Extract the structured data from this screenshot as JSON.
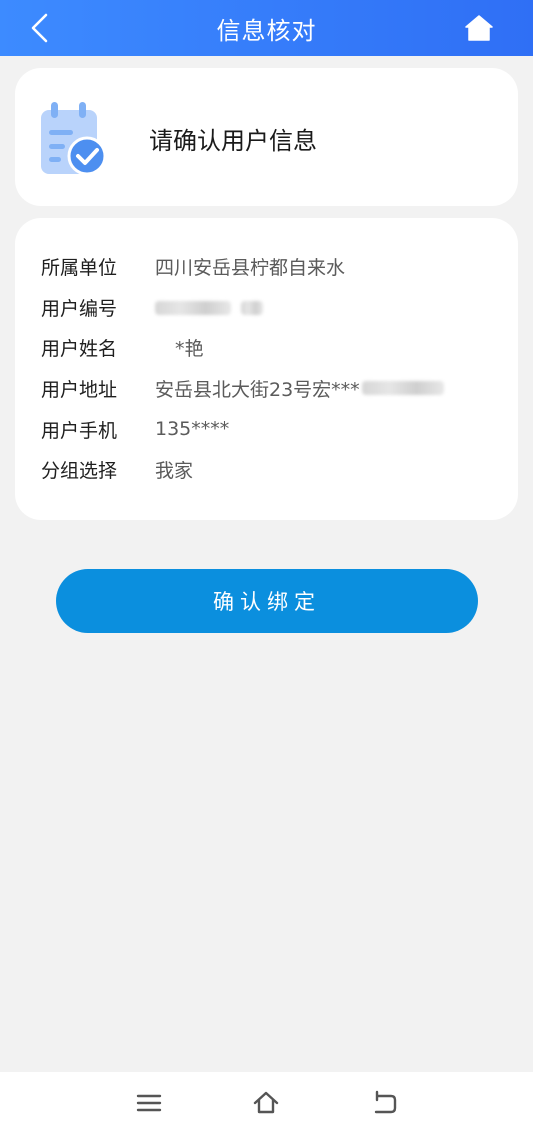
{
  "header": {
    "title": "信息核对",
    "back_icon": "chevron-left-icon",
    "home_icon": "home-icon"
  },
  "confirm_card": {
    "heading": "请确认用户信息",
    "icon": "calendar-check-icon"
  },
  "info": {
    "rows": [
      {
        "label": "所属单位",
        "value": "四川安岳县柠都自来水"
      },
      {
        "label": "用户编号",
        "value": ""
      },
      {
        "label": "用户姓名",
        "value": "*艳"
      },
      {
        "label": "用户地址",
        "value": "安岳县北大街23号宏***"
      },
      {
        "label": "用户手机",
        "value": "135****"
      },
      {
        "label": "分组选择",
        "value": "我家"
      }
    ]
  },
  "bind_button": {
    "label": "确认绑定"
  },
  "system_nav": {
    "menu_icon": "menu-icon",
    "home_icon": "home-outline-icon",
    "back_icon": "back-icon"
  },
  "colors": {
    "header_start": "#3d8bff",
    "header_end": "#2f6ff5",
    "button": "#0b8fde",
    "background": "#f2f2f2"
  }
}
